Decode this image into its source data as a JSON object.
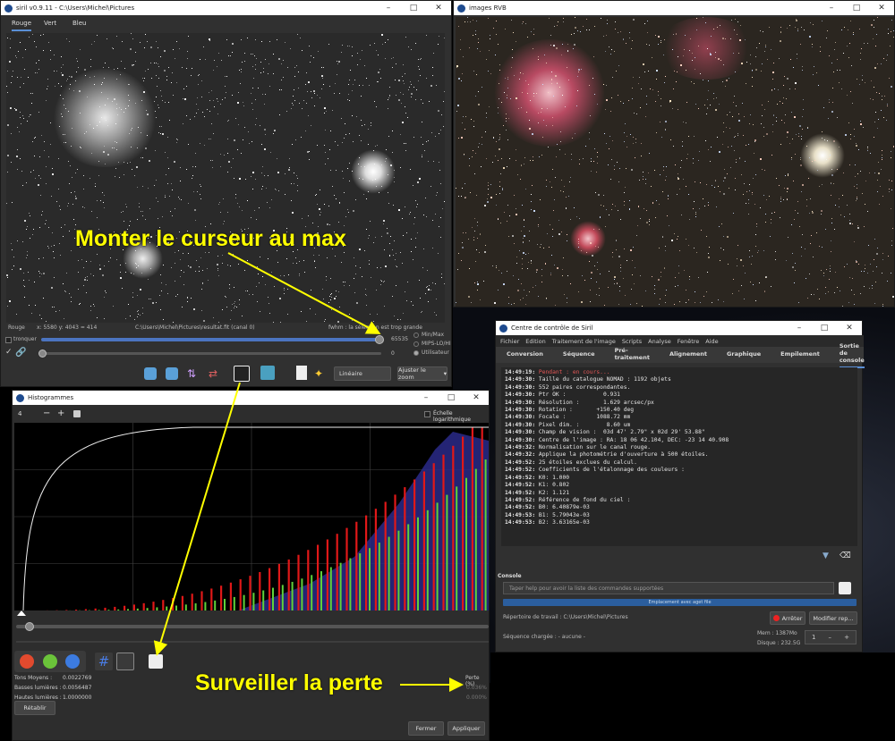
{
  "siril_window": {
    "title": "siril v0.9.11 - C:\\Users\\Michel\\Pictures",
    "tabs": [
      "Rouge",
      "Vert",
      "Bleu"
    ],
    "status_channel": "Rouge",
    "status_coords": "x: 5580 y: 4043 = 414",
    "status_path": "C:\\Users\\Michel\\Pictures\\resultat.fit (canal 0)",
    "status_fwhm": "fwhm : la sélection est trop grande",
    "slider_value_high": "65535",
    "slider_value_low": "0",
    "checkbox_label": "tronquer",
    "radio_minmax": "Min/Max",
    "radio_mips": "MIPS-LO/HI",
    "radio_user": "Utilisateur",
    "dropdown_mode": "Linéaire",
    "dropdown_zoom": "Ajuster le zoom"
  },
  "rgb_window": {
    "title": "images RVB"
  },
  "histogram_window": {
    "title": "Histogrammes",
    "zoom_value": "4",
    "zoom_minus": "−",
    "zoom_plus": "+",
    "log_scale_label": "Échelle logarithmique",
    "stats": {
      "midtones_label": "Tons Moyens :",
      "midtones_value": "0.0022769",
      "shadows_label": "Basses lumières :",
      "shadows_value": "0.0056487",
      "highlights_label": "Hautes lumières :",
      "highlights_value": "1.0000000",
      "loss_label": "Perte (%)",
      "loss_shadows": "0.036%",
      "loss_highlights": "0.000%"
    },
    "reset_button": "Rétablir",
    "close_button": "Fermer",
    "apply_button": "Appliquer"
  },
  "control_window": {
    "title": "Centre de contrôle de Siril",
    "menu": [
      "Fichier",
      "Edition",
      "Traitement de l'image",
      "Scripts",
      "Analyse",
      "Fenêtre",
      "Aide"
    ],
    "tabs": [
      "Conversion",
      "Séquence",
      "Pré-traitement",
      "Alignement",
      "Graphique",
      "Empilement",
      "Sortie de console"
    ],
    "console_lines": [
      {
        "time": "14:49:19:",
        "text": " Pendant : en cours...",
        "color": "#e25555"
      },
      {
        "time": "14:49:30:",
        "text": " Taille du catalogue NOMAD : 1192 objets",
        "color": "#e6e6e6"
      },
      {
        "time": "14:49:30:",
        "text": " 552 paires correspondantes.",
        "color": "#e6e6e6"
      },
      {
        "time": "14:49:30:",
        "text": " Ptr OK :           0.931",
        "color": "#e6e6e6"
      },
      {
        "time": "14:49:30:",
        "text": " Résolution :       1.629 arcsec/px",
        "color": "#e6e6e6"
      },
      {
        "time": "14:49:30:",
        "text": " Rotation :       +150.40 deg",
        "color": "#e6e6e6"
      },
      {
        "time": "14:49:30:",
        "text": " Focale :         1088.72 mm",
        "color": "#e6e6e6"
      },
      {
        "time": "14:49:30:",
        "text": " Pixel dim. :        8.60 um",
        "color": "#e6e6e6"
      },
      {
        "time": "14:49:30:",
        "text": " Champ de vision :  03d 47' 2.79\" x 02d 29' 53.88\"",
        "color": "#e6e6e6"
      },
      {
        "time": "14:49:30:",
        "text": " Centre de l'image : RA: 18 06 42.104, DEC: -23 14 40.908",
        "color": "#e6e6e6"
      },
      {
        "time": "14:49:32:",
        "text": " Normalisation sur le canal rouge.",
        "color": "#e6e6e6"
      },
      {
        "time": "14:49:32:",
        "text": " Applique la photométrie d'ouverture à 500 étoiles.",
        "color": "#e6e6e6"
      },
      {
        "time": "14:49:52:",
        "text": " 25 étoiles exclues du calcul.",
        "color": "#e6e6e6"
      },
      {
        "time": "14:49:52:",
        "text": " Coefficients de l'étalonnage des couleurs :",
        "color": "#e6e6e6"
      },
      {
        "time": "14:49:52:",
        "text": " K0: 1.000",
        "color": "#e6e6e6"
      },
      {
        "time": "14:49:52:",
        "text": " K1: 0.802",
        "color": "#e6e6e6"
      },
      {
        "time": "14:49:52:",
        "text": " K2: 1.121",
        "color": "#e6e6e6"
      },
      {
        "time": "14:49:52:",
        "text": " Référence de fond du ciel :",
        "color": "#e6e6e6"
      },
      {
        "time": "14:49:52:",
        "text": " B0: 6.40879e-03",
        "color": "#e6e6e6"
      },
      {
        "time": "14:49:53:",
        "text": " B1: 5.79043e-03",
        "color": "#e6e6e6"
      },
      {
        "time": "14:49:53:",
        "text": " B2: 3.63165e-03",
        "color": "#e6e6e6"
      }
    ],
    "console_label": "Console",
    "console_placeholder": "Taper help pour avoir la liste des commandes supportées",
    "progress_text": "Emplacement avec aget file",
    "workdir": "Répertoire de travail : C:\\Users\\Michel\\Pictures",
    "sequence": "Séquence chargée : - aucune -",
    "stop_button": "Arrêter",
    "modify_button": "Modifier rep...",
    "mem": "Mem : 1387Mo",
    "disk": "Disque : 232.5G",
    "spin_value": "1"
  },
  "annotations": {
    "top": "Monter le curseur au max",
    "bottom": "Surveiller la perte"
  }
}
